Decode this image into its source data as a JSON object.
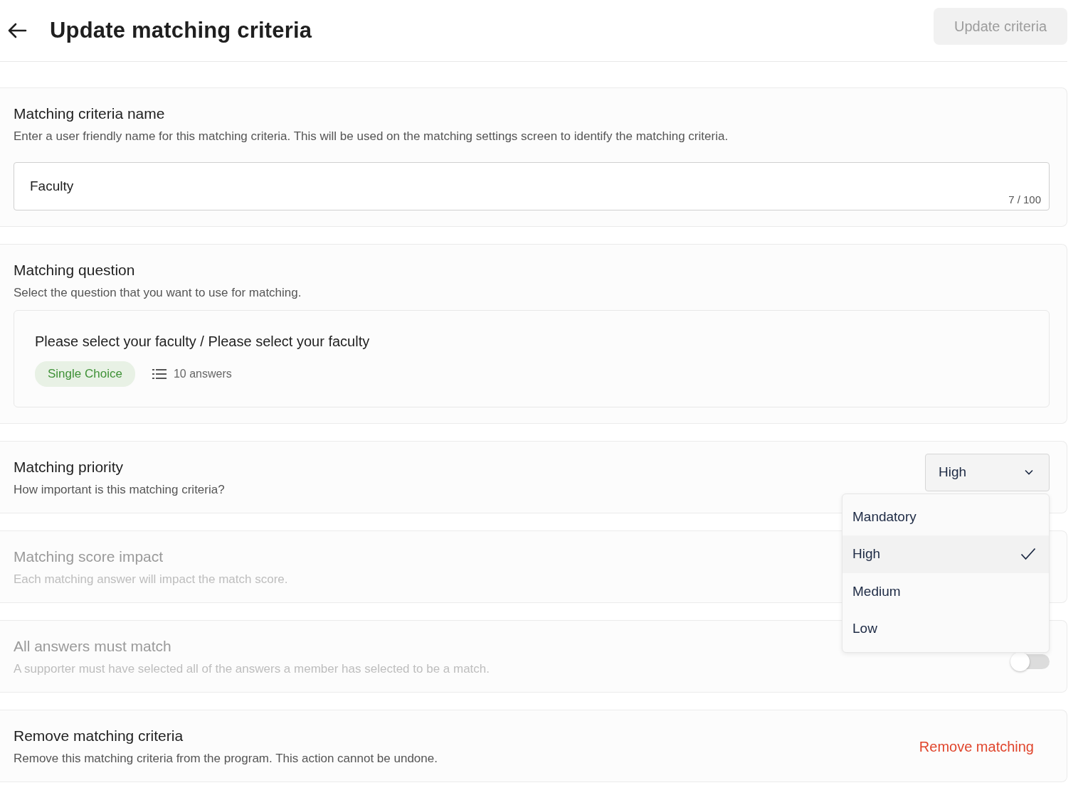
{
  "header": {
    "title": "Update matching criteria",
    "update_button": {
      "label": "Update criteria",
      "disabled": true
    }
  },
  "sections": [
    {
      "kind": "name",
      "title": "Matching criteria name",
      "description": "Enter a user friendly name for this matching criteria. This will be used on the matching settings screen to identify the matching criteria.",
      "disabled": false,
      "input": {
        "value": "Faculty",
        "counter": "7 / 100"
      }
    },
    {
      "kind": "question",
      "title": "Matching question",
      "description": "Select the question that you want to use for matching.",
      "disabled": false,
      "question": {
        "text": "Please select your faculty / Please select your faculty",
        "type_badge": "Single Choice",
        "answers": "10 answers"
      }
    },
    {
      "kind": "priority",
      "title": "Matching priority",
      "description": "How important is this matching criteria?",
      "disabled": false,
      "select": {
        "value": "High",
        "expanded": true,
        "options": [
          {
            "label": "Mandatory",
            "selected": false
          },
          {
            "label": "High",
            "selected": true
          },
          {
            "label": "Medium",
            "selected": false
          },
          {
            "label": "Low",
            "selected": false
          }
        ]
      }
    },
    {
      "kind": "plain",
      "title": "Matching score impact",
      "description": "Each matching answer will impact the match score.",
      "disabled": true
    },
    {
      "kind": "toggle",
      "title": "All answers must match",
      "description": "A supporter must have selected all of the answers a member has selected to be a match.",
      "disabled": true,
      "on": false
    },
    {
      "kind": "remove",
      "title": "Remove matching criteria",
      "description": "Remove this matching criteria from the program. This action cannot be undone.",
      "disabled": false,
      "action": "Remove matching"
    }
  ]
}
